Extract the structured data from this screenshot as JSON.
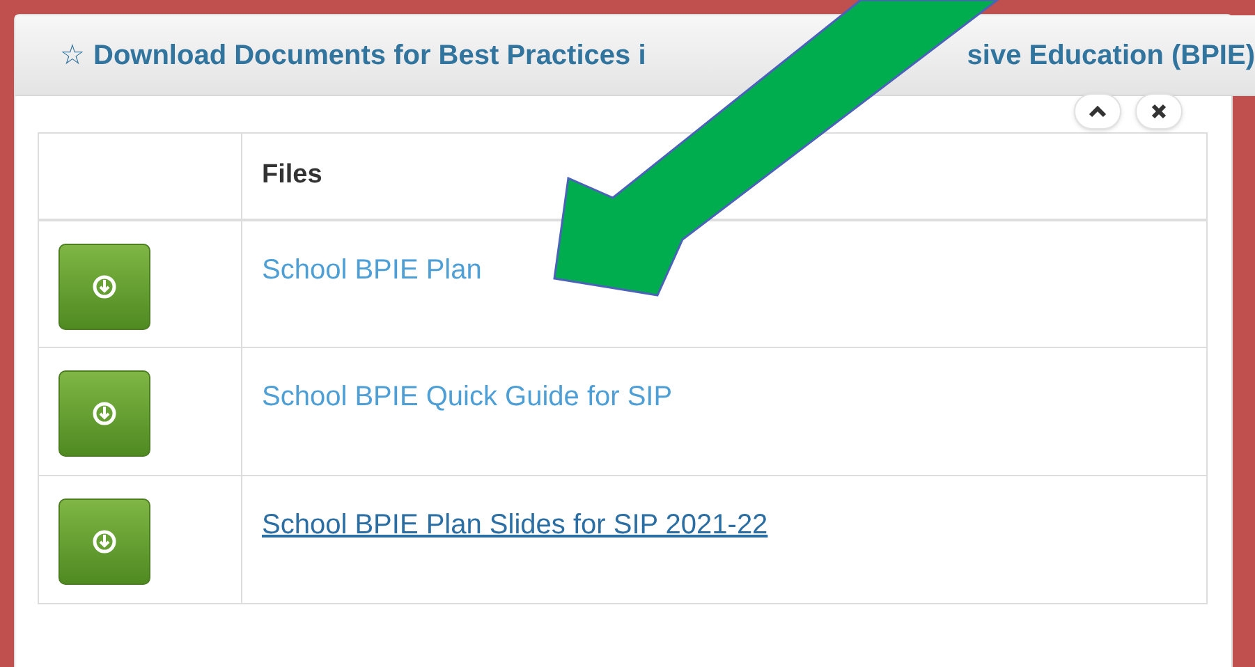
{
  "panel": {
    "star": "☆",
    "title_parts": [
      "Download Documents for Best Practices i",
      "sive Education (BPIE)"
    ],
    "controls": [
      {
        "kind": "collapse"
      },
      {
        "kind": "close"
      }
    ]
  },
  "table": {
    "columns": [
      "",
      "Files"
    ],
    "rows": [
      {
        "file": "School BPIE Plan",
        "underlined": false
      },
      {
        "file": "School BPIE Quick Guide for SIP",
        "underlined": false
      },
      {
        "file": "School BPIE Plan Slides for SIP 2021-22",
        "underlined": true
      }
    ]
  },
  "annotation": {
    "kind": "arrow"
  }
}
